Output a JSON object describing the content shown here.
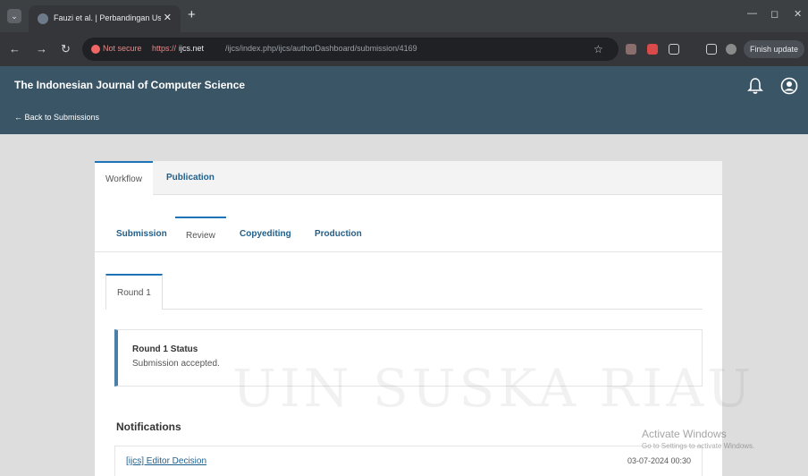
{
  "browser": {
    "tab_title": "Fauzi et al. | Perbandingan Usa",
    "tab_close": "✕",
    "new_tab": "+",
    "not_secure": "Not secure",
    "url_scheme": "https://",
    "url_host": "ijcs.net",
    "url_path": "/ijcs/index.php/ijcs/authorDashboard/submission/4169",
    "finish_update": "Finish update"
  },
  "header": {
    "journal_title": "The Indonesian Journal of Computer Science",
    "back_link": "← Back to Submissions"
  },
  "main_tabs": [
    {
      "label": "Workflow"
    },
    {
      "label": "Publication"
    }
  ],
  "stage_tabs": [
    {
      "label": "Submission"
    },
    {
      "label": "Review"
    },
    {
      "label": "Copyediting"
    },
    {
      "label": "Production"
    }
  ],
  "round": {
    "tab_label": "Round 1",
    "status_title": "Round 1 Status",
    "status_text": "Submission accepted."
  },
  "notifications": {
    "heading": "Notifications",
    "items": [
      {
        "title": "[ijcs] Editor Decision",
        "date": "03-07-2024 00:30"
      }
    ]
  },
  "overlay": {
    "watermark": "UIN SUSKA RIAU",
    "activate_title": "Activate Windows",
    "activate_sub": "Go to Settings to activate Windows."
  },
  "colors": {
    "header_bg": "#3a5566",
    "link": "#1f5f8c",
    "accent": "#1f73b7"
  }
}
